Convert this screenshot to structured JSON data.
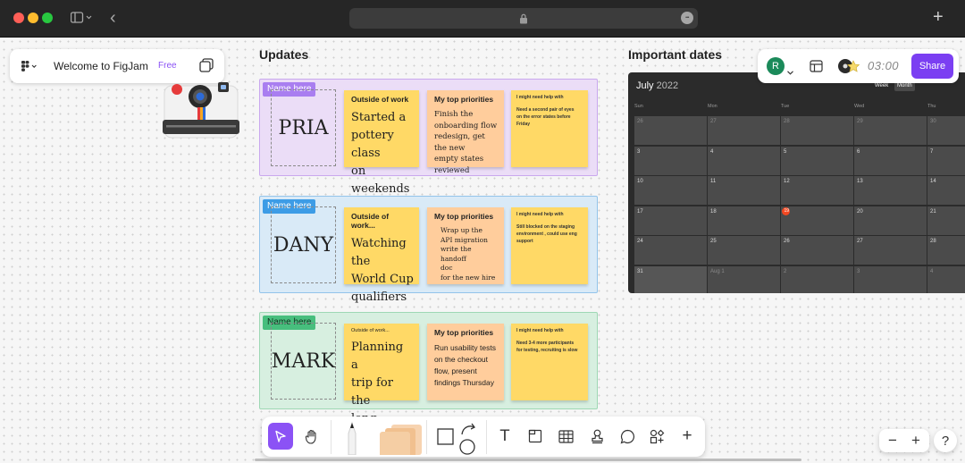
{
  "browser": {
    "new_tab_glyph": "+",
    "back_glyph": "‹",
    "more_glyph": "•••"
  },
  "header": {
    "logo": "figjam-logo-icon",
    "title": "Welcome to FigJam",
    "badge": "Free"
  },
  "top_right": {
    "avatar_letter": "R",
    "avatar_color": "#1b8a5a",
    "timer": "03:00",
    "share_label": "Share",
    "share_color": "#7b3ff2"
  },
  "updates": {
    "title": "Updates",
    "rows": [
      {
        "tag": "Name here",
        "name": "PRIA",
        "bg": "#ebddf7",
        "border": "#c9a8ee",
        "tag_color": "#a97ef0",
        "outside_head": "Outside of work",
        "outside_text": [
          "Started a",
          "pottery class",
          "on weekends"
        ],
        "priorities_head": "My top priorities",
        "priorities_text": [
          "Finish the",
          "onboarding flow",
          "redesign, get the new",
          "empty states reviewed"
        ],
        "help_head": "I might need help with",
        "help_text": [
          "Need a second pair of eyes",
          "on the error states before",
          "Friday"
        ]
      },
      {
        "tag": "Name here",
        "name": "DANY",
        "bg": "#d9eaf7",
        "border": "#93c4ea",
        "tag_color": "#3d9ce6",
        "outside_head": "Outside of work...",
        "outside_text": [
          "Watching the",
          "World Cup",
          "qualifiers"
        ],
        "priorities_head": "My top priorities",
        "priorities_text": [
          "Wrap up the",
          "API migration",
          "write the handoff",
          "doc",
          "for the new hire"
        ],
        "help_head": "I might need help with",
        "help_text": [
          "Still blocked on the staging",
          "environment , could use eng",
          "support"
        ]
      },
      {
        "tag": "Name here",
        "name": "MARK",
        "bg": "#d7efe0",
        "border": "#9ed8b4",
        "tag_color": "#47be7d",
        "outside_head": "Outside of work...",
        "outside_text": [
          "Planning a",
          "trip for the",
          "long weekend"
        ],
        "priorities_head": "My top priorities",
        "priorities_text": [
          "Run usability tests",
          "on the checkout",
          "flow, present",
          "findings Thursday"
        ],
        "help_head": "I might need help with",
        "help_text": [
          "Need 3-4 more participants",
          "for testing, recruiting is slow"
        ]
      }
    ]
  },
  "dates": {
    "title": "Important dates",
    "calendar": {
      "month": "July",
      "year": "2022",
      "view_week": "Week",
      "view_month": "Month",
      "days": [
        "Sun",
        "Mon",
        "Tue",
        "Wed",
        "Thu"
      ],
      "weeks": [
        [
          "26",
          "27",
          "28",
          "29",
          "30"
        ],
        [
          "3",
          "4",
          "5",
          "6",
          "7"
        ],
        [
          "10",
          "11",
          "12",
          "13",
          "14"
        ],
        [
          "17",
          "18",
          "19",
          "20",
          "21"
        ],
        [
          "24",
          "25",
          "26",
          "27",
          "28"
        ],
        [
          "31",
          "Aug 1",
          "2",
          "3",
          "4"
        ]
      ],
      "today": "19"
    }
  },
  "bottom_toolbar": {
    "tools": [
      "select-arrow-icon",
      "hand-icon",
      "marker-icon",
      "sticky-stack-icon",
      "shapes-icon",
      "text-icon",
      "section-icon",
      "table-icon",
      "stamp-icon",
      "comment-icon",
      "widgets-icon",
      "plus-icon"
    ],
    "text_glyph": "T",
    "plus_glyph": "+"
  },
  "zoom": {
    "minus": "−",
    "plus": "+",
    "help": "?"
  }
}
